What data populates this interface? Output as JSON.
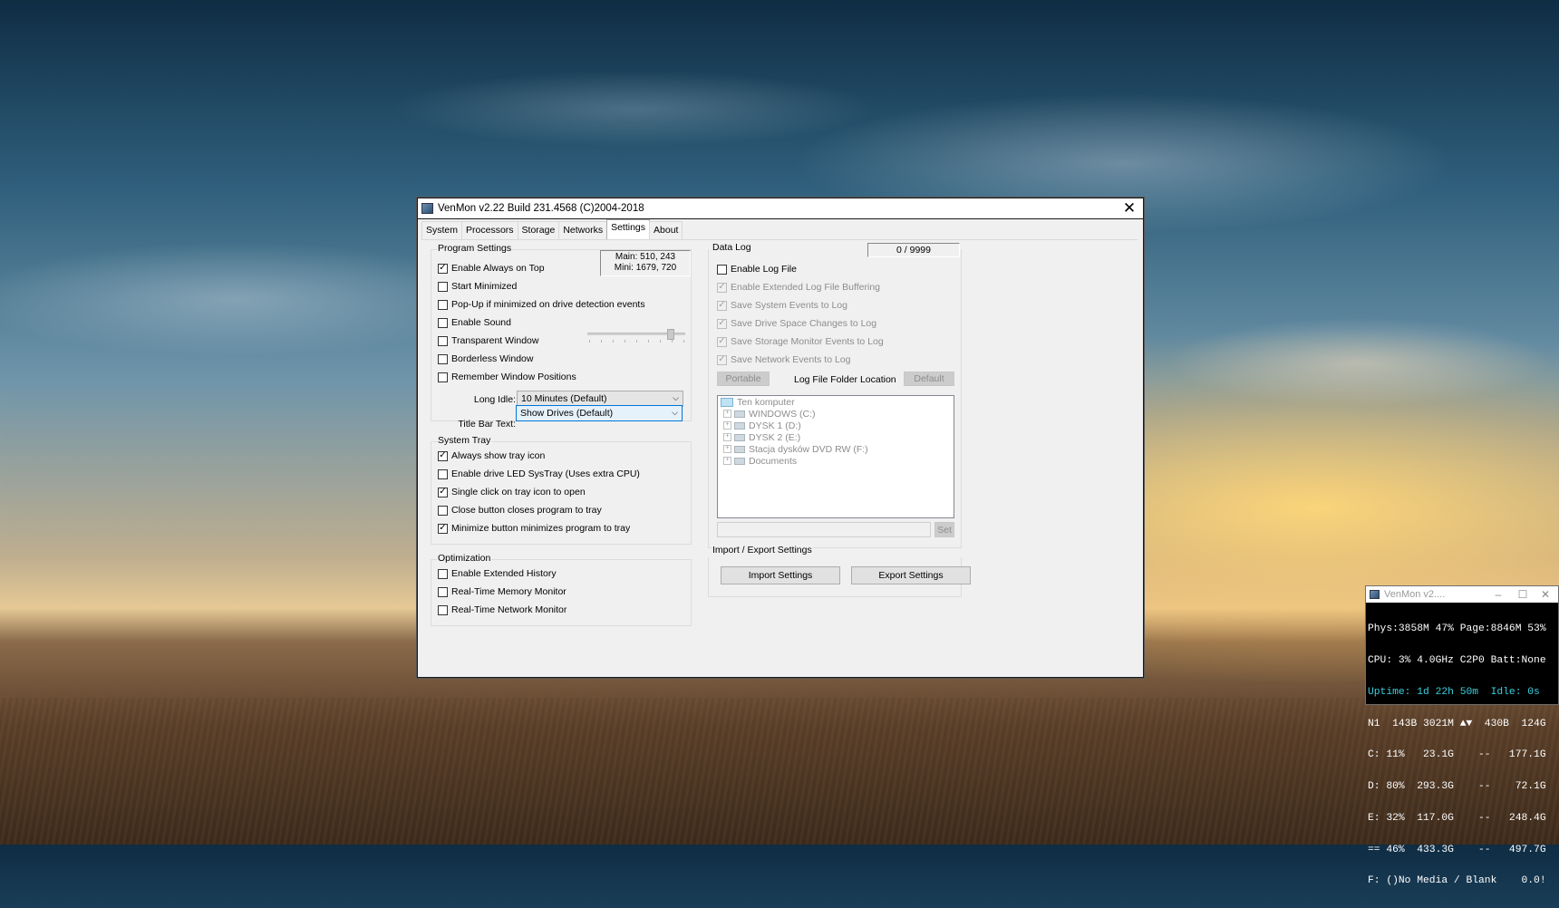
{
  "window": {
    "title": "VenMon v2.22 Build 231.4568 (C)2004-2018",
    "close_glyph": "✕"
  },
  "tabs": [
    {
      "label": "System"
    },
    {
      "label": "Processors"
    },
    {
      "label": "Storage"
    },
    {
      "label": "Networks"
    },
    {
      "label": "Settings",
      "active": true
    },
    {
      "label": "About"
    }
  ],
  "program_settings": {
    "label": "Program Settings",
    "coords_main": "Main: 510, 243",
    "coords_mini": "Mini: 1679, 720",
    "options": [
      {
        "label": "Enable Always on Top",
        "checked": true
      },
      {
        "label": "Start Minimized",
        "checked": false
      },
      {
        "label": "Pop-Up if minimized on drive detection events",
        "checked": false
      },
      {
        "label": "Enable Sound",
        "checked": false
      },
      {
        "label": "Transparent Window",
        "checked": false
      },
      {
        "label": "Borderless Window",
        "checked": false
      },
      {
        "label": "Remember Window Positions",
        "checked": false
      }
    ],
    "long_idle_label": "Long Idle:",
    "long_idle_value": "10 Minutes (Default)",
    "title_bar_label": "Title Bar Text:",
    "title_bar_value": "Show Drives (Default)"
  },
  "system_tray": {
    "label": "System Tray",
    "options": [
      {
        "label": "Always show tray icon",
        "checked": true
      },
      {
        "label": "Enable drive LED SysTray (Uses extra CPU)",
        "checked": false
      },
      {
        "label": "Single click on tray icon to open",
        "checked": true
      },
      {
        "label": "Close button closes program to tray",
        "checked": false
      },
      {
        "label": "Minimize button minimizes program to tray",
        "checked": true
      }
    ]
  },
  "optimization": {
    "label": "Optimization",
    "options": [
      {
        "label": "Enable Extended History",
        "checked": false
      },
      {
        "label": "Real-Time Memory Monitor",
        "checked": false
      },
      {
        "label": "Real-Time Network Monitor",
        "checked": false
      }
    ]
  },
  "data_log": {
    "label": "Data Log",
    "counter": "0 / 9999",
    "options": [
      {
        "label": "Enable Log File",
        "checked": false,
        "enabled": true
      },
      {
        "label": "Enable Extended Log File Buffering",
        "checked": true,
        "enabled": false
      },
      {
        "label": "Save System Events to Log",
        "checked": true,
        "enabled": false
      },
      {
        "label": "Save Drive Space Changes to Log",
        "checked": true,
        "enabled": false
      },
      {
        "label": "Save Storage Monitor Events to Log",
        "checked": true,
        "enabled": false
      },
      {
        "label": "Save Network Events to Log",
        "checked": true,
        "enabled": false
      }
    ],
    "portable_button": "Portable",
    "folder_location_label": "Log File Folder Location",
    "default_button": "Default",
    "tree": [
      {
        "label": "Ten komputer",
        "icon": "computer-icon",
        "level": 0
      },
      {
        "label": "WINDOWS (C:)",
        "icon": "drive-icon",
        "level": 1
      },
      {
        "label": "DYSK 1 (D:)",
        "icon": "drive-icon",
        "level": 1
      },
      {
        "label": "DYSK 2 (E:)",
        "icon": "drive-icon",
        "level": 1
      },
      {
        "label": "Stacja dysków DVD RW (F:)",
        "icon": "dvd-drive-icon",
        "level": 1
      },
      {
        "label": "Documents",
        "icon": "documents-icon",
        "level": 1
      }
    ],
    "path_value": "",
    "set_button": "Set"
  },
  "import_export": {
    "label": "Import / Export Settings",
    "import_button": "Import Settings",
    "export_button": "Export Settings"
  },
  "mini_window": {
    "title": "VenMon v2....",
    "lines": [
      {
        "text": "Phys:3858M 47% Page:8846M 53%",
        "accent": false
      },
      {
        "text": "CPU: 3% 4.0GHz C2P0 Batt:None",
        "accent": false
      },
      {
        "text": "Uptime: 1d 22h 50m  Idle: 0s",
        "accent": true
      },
      {
        "text": "N1  143B 3021M ▲▼  430B  124G",
        "accent": false
      },
      {
        "text": "C: 11%   23.1G    --   177.1G",
        "accent": false
      },
      {
        "text": "D: 80%  293.3G    --    72.1G",
        "accent": false
      },
      {
        "text": "E: 32%  117.0G    --   248.4G",
        "accent": false
      },
      {
        "text": "== 46%  433.3G    --   497.7G",
        "accent": false
      },
      {
        "text": "F: ()No Media / Blank    0.0!",
        "accent": false
      }
    ]
  }
}
